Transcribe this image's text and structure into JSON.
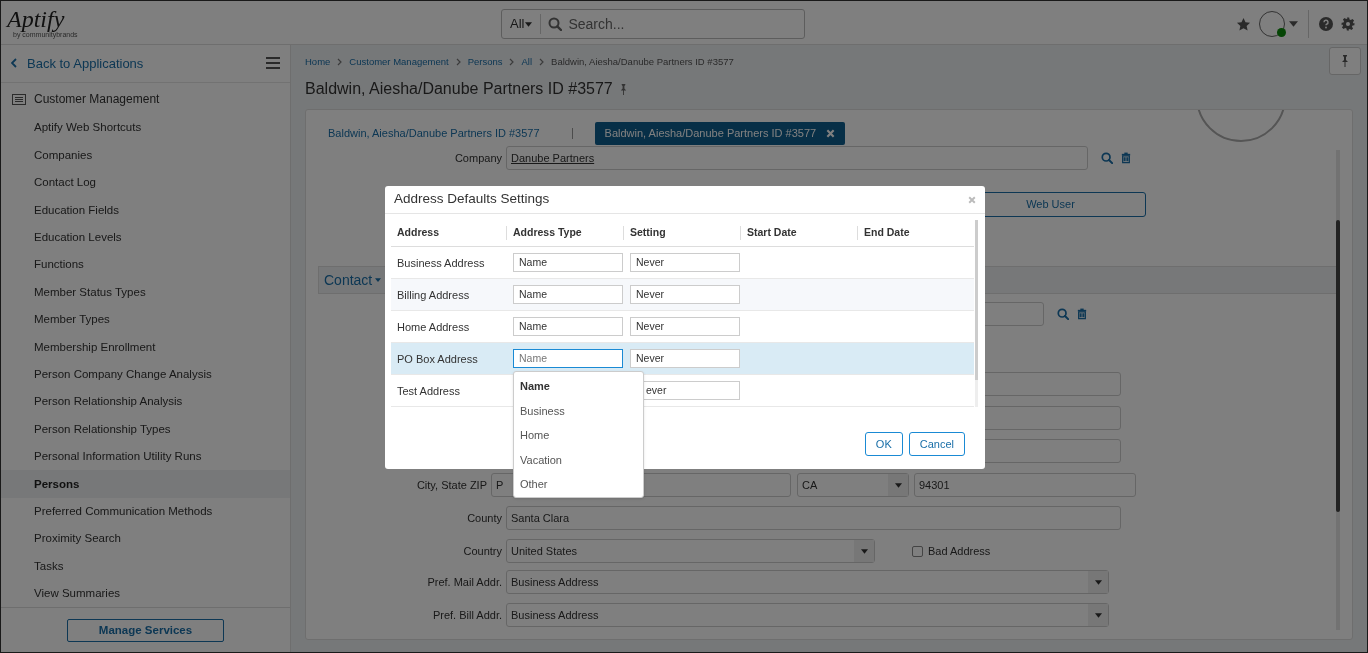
{
  "header": {
    "logo": "Aptify",
    "logo_tagline": "by communitybrands",
    "search": {
      "scope": "All",
      "placeholder": "Search..."
    }
  },
  "sidebar": {
    "back": "Back to Applications",
    "section": "Customer Management",
    "items": [
      {
        "label": "Aptify Web Shortcuts",
        "selected": false
      },
      {
        "label": "Companies",
        "selected": false
      },
      {
        "label": "Contact Log",
        "selected": false
      },
      {
        "label": "Education Fields",
        "selected": false
      },
      {
        "label": "Education Levels",
        "selected": false
      },
      {
        "label": "Functions",
        "selected": false
      },
      {
        "label": "Member Status Types",
        "selected": false
      },
      {
        "label": "Member Types",
        "selected": false
      },
      {
        "label": "Membership Enrollment",
        "selected": false
      },
      {
        "label": "Person Company Change Analysis",
        "selected": false
      },
      {
        "label": "Person Relationship Analysis",
        "selected": false
      },
      {
        "label": "Person Relationship Types",
        "selected": false
      },
      {
        "label": "Personal Information Utility Runs",
        "selected": false
      },
      {
        "label": "Persons",
        "selected": true
      },
      {
        "label": "Preferred Communication Methods",
        "selected": false
      },
      {
        "label": "Proximity Search",
        "selected": false
      },
      {
        "label": "Tasks",
        "selected": false
      },
      {
        "label": "View Summaries",
        "selected": false
      }
    ],
    "button": "Manage Services"
  },
  "breadcrumb": [
    "Home",
    "Customer Management",
    "Persons",
    "All",
    "Baldwin, Aiesha/Danube Partners ID #3577"
  ],
  "page_title": "Baldwin, Aiesha/Danube Partners ID #3577",
  "tabs": [
    {
      "label": "Baldwin, Aiesha/Danube Partners ID #3577",
      "selected": false
    },
    {
      "label": "Baldwin, Aiesha/Danube Partners ID #3577",
      "selected": true
    }
  ],
  "form": {
    "company": {
      "label": "Company",
      "value": "Danube Partners"
    },
    "web_user_button": "Web User",
    "section": "Contact",
    "city": {
      "label": "City, State ZIP",
      "city": "P",
      "state": "CA",
      "zip": "94301"
    },
    "county": {
      "label": "County",
      "value": "Santa Clara"
    },
    "country": {
      "label": "Country",
      "value": "United States"
    },
    "bad_address": {
      "label": "Bad Address",
      "checked": false
    },
    "pref_mail": {
      "label": "Pref. Mail Addr.",
      "value": "Business Address"
    },
    "pref_bill": {
      "label": "Pref. Bill Addr.",
      "value": "Business Address"
    }
  },
  "dialog": {
    "title": "Address Defaults Settings",
    "columns": [
      "Address",
      "Address Type",
      "Setting",
      "Start Date",
      "End Date"
    ],
    "rows": [
      {
        "address": "Business Address",
        "type": "Name",
        "setting": "Never",
        "selected": false
      },
      {
        "address": "Billing Address",
        "type": "Name",
        "setting": "Never",
        "selected": false
      },
      {
        "address": "Home Address",
        "type": "Name",
        "setting": "Never",
        "selected": false
      },
      {
        "address": "PO Box Address",
        "type": "Name",
        "setting": "Never",
        "selected": true
      },
      {
        "address": "Test Address",
        "setting": "ever",
        "selected": false
      }
    ],
    "dropdown": [
      {
        "label": "Name",
        "selected": true
      },
      {
        "label": "Business",
        "selected": false
      },
      {
        "label": "Home",
        "selected": false
      },
      {
        "label": "Vacation",
        "selected": false
      },
      {
        "label": "Other",
        "selected": false
      }
    ],
    "buttons": [
      "OK",
      "Cancel"
    ]
  }
}
